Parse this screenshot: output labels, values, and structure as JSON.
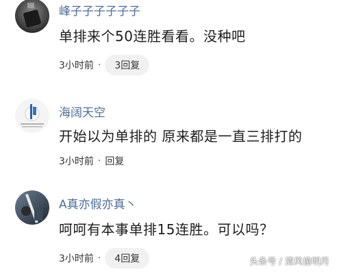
{
  "comments": [
    {
      "username": "峰子子子子子子",
      "content": "单排来个50连胜看看。没种吧",
      "time": "3小时前",
      "separator": "·",
      "reply": "3回复"
    },
    {
      "username": "海阔天空",
      "content": "开始以为单排的 原来都是一直三排打的",
      "time": "3小时前",
      "separator": "·",
      "reply": "回复"
    },
    {
      "username": "A真亦假亦真丶",
      "content": "呵呵有本事单排15连胜。可以吗？",
      "time": "3小时前",
      "separator": "·",
      "reply": "4回复"
    }
  ],
  "watermark": "头条号 / 清风偷明月",
  "colors": {
    "username": "#4b6d99",
    "content": "#1d1d1d",
    "meta": "#333333",
    "reply_pill_bg": "#f1f1f1"
  }
}
